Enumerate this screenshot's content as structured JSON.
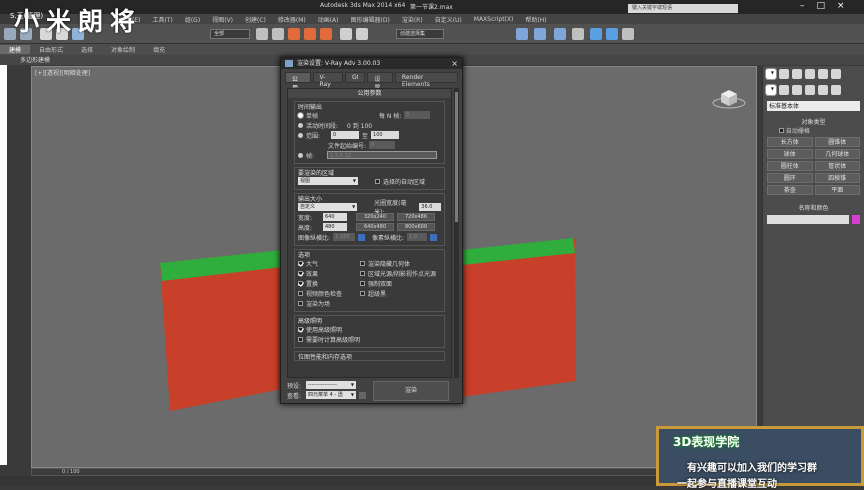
{
  "app": {
    "title": "Autodesk 3ds Max  2014 x64",
    "file": "第一节课2.max",
    "search_placeholder": "键入关键字或短语",
    "watermark": "小米朗将",
    "user_label": "S.玉(管理)",
    "menu": [
      "编辑(E)",
      "工具(T)",
      "组(G)",
      "视图(V)",
      "创建(C)",
      "修改器(M)",
      "动画(A)",
      "图形编辑器(D)",
      "渲染(R)",
      "自定义(U)",
      "MAXScript(X)",
      "帮助(H)"
    ]
  },
  "toolbar": {
    "selection_filter": "全部",
    "reference_coord": "视图",
    "named_selection": "创建选择集"
  },
  "ribbon": {
    "tabs": [
      "建模",
      "自由形式",
      "选择",
      "对象绘制",
      "填充"
    ],
    "active_tab": "建模",
    "sub_label": "多边形建模"
  },
  "viewport": {
    "label": "[+][透视][明暗处理]",
    "colors": {
      "box_red": "#c8402a",
      "box_green": "#2fae3d",
      "bg": "#6b6b6b"
    }
  },
  "command_panel": {
    "category": "标准基本体",
    "rollout_type": "对象类型",
    "autogrid": "自动栅格",
    "objects": [
      "长方体",
      "圆锥体",
      "球体",
      "几何球体",
      "圆柱体",
      "管状体",
      "圆环",
      "四棱锥",
      "茶壶",
      "平面"
    ],
    "name_color": "名称和颜色",
    "swatch_color": "#d63fce"
  },
  "timeline": {
    "frame": "0 / 100"
  },
  "promo": {
    "heading": "3D表现学院",
    "line1": "有兴趣可以加入我们的学习群",
    "line2": "一起参与直播课堂互动"
  },
  "render_dialog": {
    "title": "渲染设置: V-Ray Adv 3.00.03",
    "tabs": [
      "公用",
      "V-Ray",
      "GI",
      "设置",
      "Render Elements"
    ],
    "active_tab": "公用",
    "section": "公用参数",
    "time_output": {
      "title": "时间输出",
      "single": "单帧",
      "every_nth": "每 N 帧:",
      "every_nth_value": "1",
      "active_segment": "活动时间段:",
      "active_range": "0 到 100",
      "range": "范围:",
      "range_from": "0",
      "range_to_label": "至",
      "range_to": "100",
      "file_start": "文件起始编号:",
      "file_start_value": "0",
      "frames": "帧:",
      "frames_value": "1,3,5-12"
    },
    "area": {
      "title": "要渲染的区域",
      "value": "视图",
      "auto_region": "选择的自动区域"
    },
    "output_size": {
      "title": "输出大小",
      "preset": "自定义",
      "aperture_label": "光圈宽度(毫米):",
      "aperture": "36.0",
      "width_label": "宽度:",
      "width": "640",
      "height_label": "高度:",
      "height": "480",
      "presets": [
        "320x240",
        "720x486",
        "640x480",
        "800x600"
      ],
      "image_aspect_label": "图像纵横比:",
      "image_aspect": "1.333",
      "pixel_aspect_label": "像素纵横比:",
      "pixel_aspect": "1.0"
    },
    "options": {
      "title": "选项",
      "left": [
        "大气",
        "效果",
        "置换",
        "视频颜色检查",
        "渲染为场"
      ],
      "left_checked": [
        true,
        true,
        true,
        false,
        false
      ],
      "right": [
        "渲染隐藏几何体",
        "区域光源/阴影视作点光源",
        "强制双面",
        "超级黑"
      ]
    },
    "advanced_lighting": {
      "title": "高级照明",
      "use": "使用高级照明",
      "compute": "需要时计算高级照明"
    },
    "bitmap_section": "位图性能和内存选项",
    "footer": {
      "preset_label": "预设:",
      "preset_value": "----------------",
      "view_label": "查看:",
      "view_value": "四元菜单 4 - 透",
      "render": "渲染"
    }
  }
}
